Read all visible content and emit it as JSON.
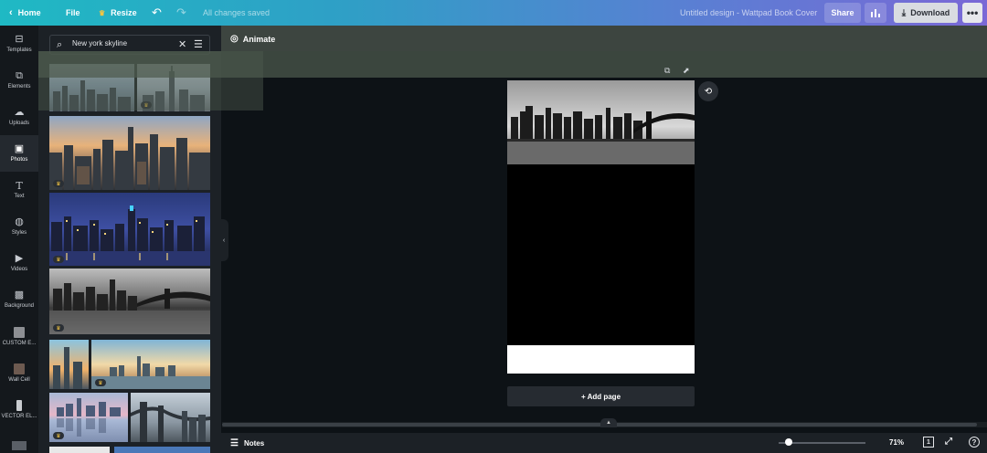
{
  "topbar": {
    "home_label": "Home",
    "file_label": "File",
    "resize_label": "Resize",
    "saved_status": "All changes saved",
    "design_title": "Untitled design - Wattpad Book Cover",
    "share_label": "Share",
    "download_label": "Download"
  },
  "rail": {
    "items": [
      {
        "label": "Templates",
        "icon": "templates-icon"
      },
      {
        "label": "Elements",
        "icon": "elements-icon"
      },
      {
        "label": "Uploads",
        "icon": "uploads-icon"
      },
      {
        "label": "Photos",
        "icon": "photos-icon"
      },
      {
        "label": "Text",
        "icon": "text-icon"
      },
      {
        "label": "Styles",
        "icon": "styles-icon"
      },
      {
        "label": "Videos",
        "icon": "videos-icon"
      },
      {
        "label": "Background",
        "icon": "background-icon"
      },
      {
        "label": "CUSTOM E...",
        "icon": "custom-elements-icon"
      },
      {
        "label": "Wall Cell",
        "icon": "wall-cell-icon"
      },
      {
        "label": "VECTOR EL...",
        "icon": "vector-elements-icon"
      }
    ],
    "active": "Photos"
  },
  "search": {
    "value": "New york skyline"
  },
  "canvas": {
    "animate_label": "Animate",
    "add_page_label": "+ Add page"
  },
  "bottombar": {
    "notes_label": "Notes",
    "zoom_value": "71%",
    "zoom_level": 0.71,
    "page_count": "1"
  },
  "colors": {
    "topbar_gradient_start": "#1fb9c4",
    "topbar_gradient_end": "#7a68d6",
    "canvas_bg": "#0d1216",
    "panel_bg": "#1c2126"
  }
}
